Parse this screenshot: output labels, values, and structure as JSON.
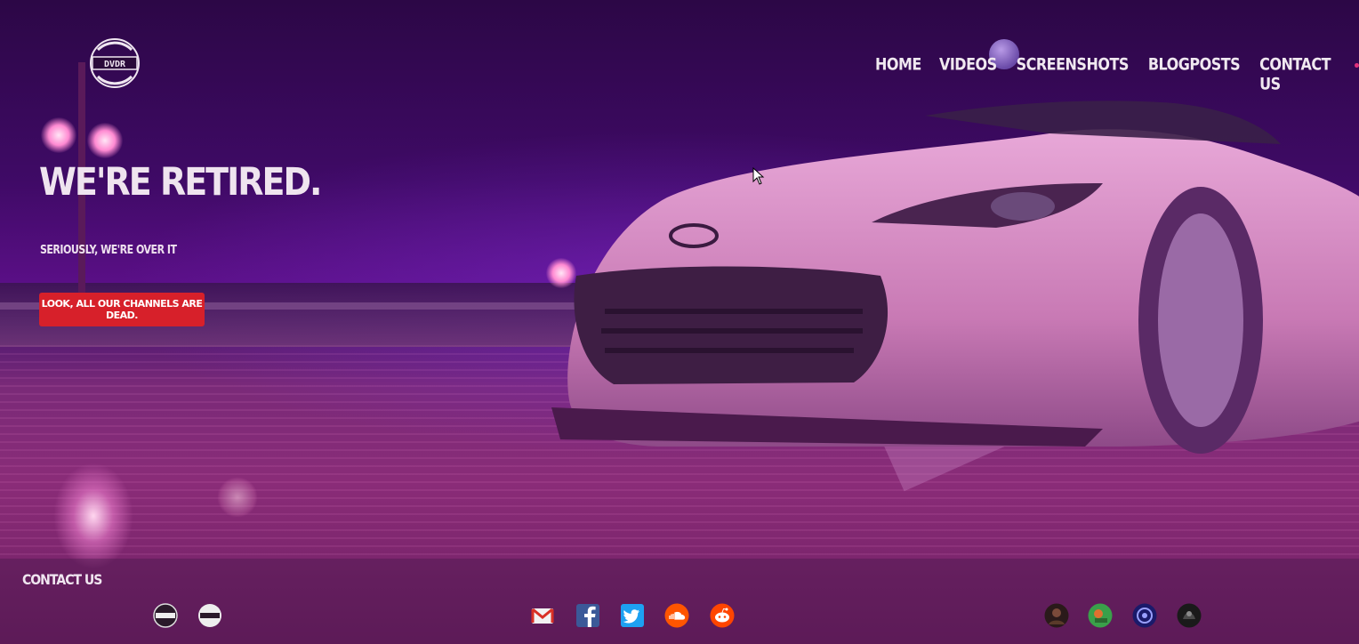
{
  "nav": {
    "items": [
      "HOME",
      "VIDEOS",
      "SCREENSHOTS",
      "BLOGPOSTS",
      "CONTACT US"
    ]
  },
  "logo": {
    "text": "DVDR"
  },
  "hero": {
    "title": "WE'RE RETIRED.",
    "subtitle": "SERIOUSLY, WE'RE OVER IT",
    "cta_label": "LOOK, ALL OUR CHANNELS ARE DEAD."
  },
  "footer": {
    "title": "CONTACT US",
    "left_icons": [
      "dvdr-badge-icon",
      "dvdr-badge-icon"
    ],
    "center_icons": [
      "gmail-icon",
      "facebook-icon",
      "twitter-icon",
      "soundcloud-icon",
      "reddit-icon"
    ],
    "right_icons": [
      "avatar-icon",
      "avatar-icon",
      "steam-like-icon",
      "avatar-icon"
    ]
  },
  "colors": {
    "accent": "#d7202a",
    "nav_dot": "#e0307a",
    "text": "#f0e8f0"
  }
}
